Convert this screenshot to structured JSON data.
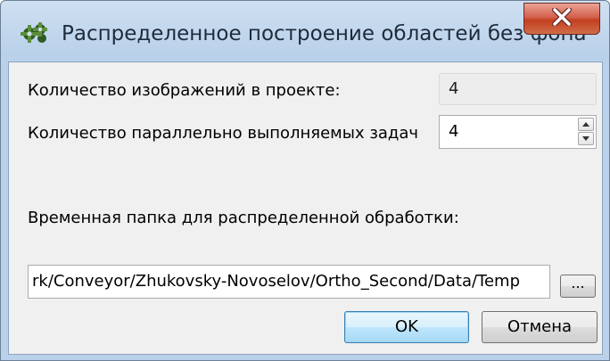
{
  "window": {
    "title": "Распределенное построение областей без фона",
    "close_symbol": "X"
  },
  "form": {
    "images_label": "Количество изображений в проекте:",
    "images_value": "4",
    "tasks_label": "Количество параллельно выполняемых задач",
    "tasks_value": "4",
    "temp_folder_label": "Временная папка для распределенной обработки:",
    "temp_folder_value": "rk/Conveyor/Zhukovsky-Novoselov/Ortho_Second/Data/Temp",
    "browse_label": "..."
  },
  "buttons": {
    "ok_label": "OK",
    "cancel_label": "Отмена"
  },
  "icons": {
    "app": "gear-cluster-icon",
    "close": "close-icon",
    "spin_up": "spin-up-icon",
    "spin_down": "spin-down-icon"
  },
  "colors": {
    "close_button": "#c3401f",
    "default_button_border": "#3c7fb1",
    "dialog_background": "#f0f0f0"
  }
}
